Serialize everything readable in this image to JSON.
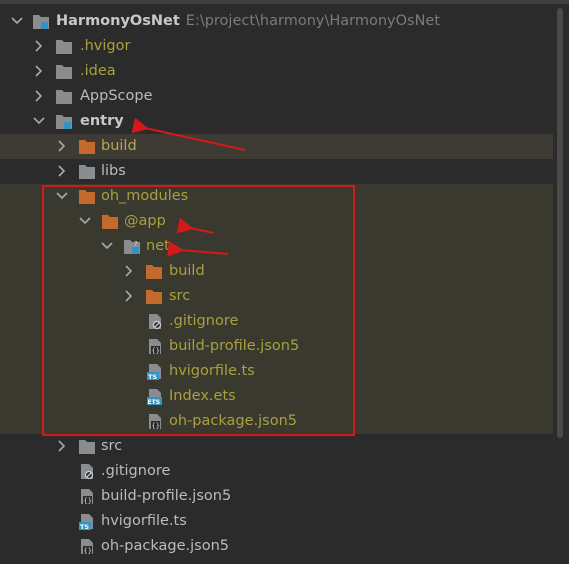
{
  "project": {
    "name": "HarmonyOsNet",
    "path": "E:\\project\\harmony\\HarmonyOsNet"
  },
  "tree": [
    {
      "label": ".hvigor",
      "type": "folder-gray",
      "color": "olive"
    },
    {
      "label": ".idea",
      "type": "folder-gray",
      "color": "olive"
    },
    {
      "label": "AppScope",
      "type": "folder-gray",
      "color": "normal"
    },
    {
      "label": "entry",
      "type": "module",
      "color": "bold"
    },
    {
      "label": "build",
      "type": "folder-orange",
      "color": "yellow"
    },
    {
      "label": "libs",
      "type": "folder-gray",
      "color": "normal"
    },
    {
      "label": "oh_modules",
      "type": "folder-orange",
      "color": "olive"
    },
    {
      "label": "@app",
      "type": "folder-orange",
      "color": "olive"
    },
    {
      "label": "net",
      "type": "module-unknown",
      "color": "olive"
    },
    {
      "label": "build",
      "type": "folder-orange",
      "color": "olive"
    },
    {
      "label": "src",
      "type": "folder-orange",
      "color": "olive"
    },
    {
      "label": ".gitignore",
      "type": "file-gitignore",
      "color": "olive"
    },
    {
      "label": "build-profile.json5",
      "type": "file-json",
      "color": "olive"
    },
    {
      "label": "hvigorfile.ts",
      "type": "file-ts",
      "color": "olive"
    },
    {
      "label": "Index.ets",
      "type": "file-ets",
      "color": "olive"
    },
    {
      "label": "oh-package.json5",
      "type": "file-json",
      "color": "olive"
    },
    {
      "label": "src",
      "type": "folder-gray",
      "color": "normal"
    },
    {
      "label": ".gitignore",
      "type": "file-gitignore",
      "color": "normal"
    },
    {
      "label": "build-profile.json5",
      "type": "file-json",
      "color": "normal"
    },
    {
      "label": "hvigorfile.ts",
      "type": "file-ts",
      "color": "normal"
    },
    {
      "label": "oh-package.json5",
      "type": "file-json",
      "color": "normal"
    }
  ],
  "icons": {
    "folder_gray": "#8a8d90",
    "folder_orange": "#c46a2d",
    "module_badge": "#3592c4",
    "annotation_red": "#d41919"
  }
}
